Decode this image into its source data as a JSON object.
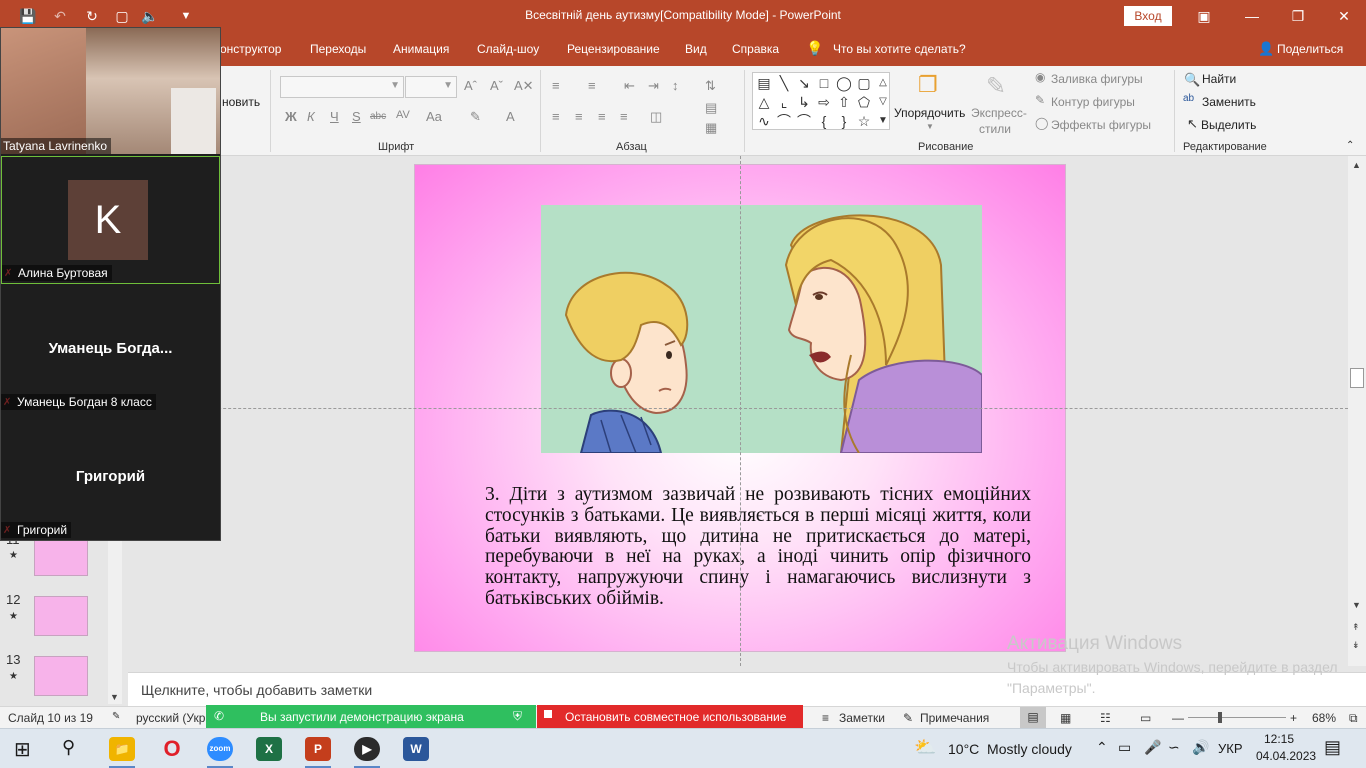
{
  "titlebar": {
    "title": "Всесвітній день аутизму[Compatibility Mode]  -  PowerPoint",
    "signin": "Вход",
    "colors": {
      "accent": "#b7472a"
    }
  },
  "tabs": [
    {
      "label": "онструктор"
    },
    {
      "label": "Переходы"
    },
    {
      "label": "Анимация"
    },
    {
      "label": "Слайд-шоу"
    },
    {
      "label": "Рецензирование"
    },
    {
      "label": "Вид"
    },
    {
      "label": "Справка"
    },
    {
      "label": "Что вы хотите сделать?"
    }
  ],
  "share_label": "Поделиться",
  "ribbon": {
    "partial_label": "новить",
    "groups": {
      "font": "Шрифт",
      "paragraph": "Абзац",
      "drawing": "Рисование",
      "editing": "Редактирование"
    },
    "font_buttons": [
      "Ж",
      "К",
      "Ч",
      "S",
      "abc",
      "AV",
      "Aa",
      "A"
    ],
    "arrange": "Упорядочить",
    "quick_styles": [
      "Экспресс-",
      "стили"
    ],
    "shape_fill": "Заливка фигуры",
    "shape_outline": "Контур фигуры",
    "shape_effects": "Эффекты фигуры",
    "find": "Найти",
    "replace": "Заменить",
    "select": "Выделить"
  },
  "thumbnails": [
    {
      "num": "11"
    },
    {
      "num": "12"
    },
    {
      "num": "13"
    }
  ],
  "slide": {
    "text": "3. Діти з аутизмом зазвичай не розвивають тісних емоційних стосунків з батьками. Це виявляється в перші місяці життя, коли батьки виявляють, що дитина не притискається до матері, перебуваючи в неї на руках, а іноді чинить опір фізичного контакту, напружуючи спину і намагаючись вислизнути з батьківських обіймів."
  },
  "notes_placeholder": "Щелкните, чтобы добавить заметки",
  "watermark": {
    "title": "Активация Windows",
    "line": "Чтобы активировать Windows, перейдите в раздел \"Параметры\"."
  },
  "statusbar": {
    "slide": "Слайд 10 из 19",
    "lang": "русский (Укр",
    "sharing": "Вы запустили демонстрацию экрана",
    "stop": "Остановить совместное использование",
    "notes": "Заметки",
    "comments": "Примечания",
    "zoom": "68%"
  },
  "zoom_participants": [
    {
      "name": "Tatyana Lavrinenko",
      "type": "video"
    },
    {
      "name": "Алина Буртовая",
      "type": "avatar",
      "initial": "K",
      "avatar_color": "#5d4037"
    },
    {
      "name": "Уманець Богдан 8 класс",
      "display": "Уманець  Богда..."
    },
    {
      "name": "Григорий",
      "display": "Григорий"
    }
  ],
  "taskbar": {
    "weather": "10°C  Mostly cloudy",
    "lang": "УКР",
    "time": "12:15",
    "date": "04.04.2023",
    "apps": [
      {
        "name": "file-explorer",
        "color": "#f0b400"
      },
      {
        "name": "opera",
        "color": "#e0202a"
      },
      {
        "name": "zoom",
        "color": "#2d8cff",
        "label": "zoom"
      },
      {
        "name": "excel",
        "color": "#1e7145",
        "label": "X"
      },
      {
        "name": "powerpoint",
        "color": "#c43e1c",
        "label": "P"
      },
      {
        "name": "media-player",
        "color": "#2b2b2b"
      },
      {
        "name": "word",
        "color": "#2b579a",
        "label": "W"
      }
    ]
  }
}
